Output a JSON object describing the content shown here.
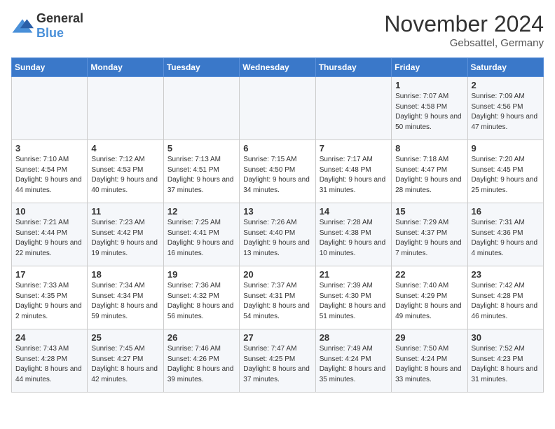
{
  "logo": {
    "general": "General",
    "blue": "Blue"
  },
  "title": "November 2024",
  "location": "Gebsattel, Germany",
  "weekdays": [
    "Sunday",
    "Monday",
    "Tuesday",
    "Wednesday",
    "Thursday",
    "Friday",
    "Saturday"
  ],
  "weeks": [
    [
      {
        "day": "",
        "sunrise": "",
        "sunset": "",
        "daylight": ""
      },
      {
        "day": "",
        "sunrise": "",
        "sunset": "",
        "daylight": ""
      },
      {
        "day": "",
        "sunrise": "",
        "sunset": "",
        "daylight": ""
      },
      {
        "day": "",
        "sunrise": "",
        "sunset": "",
        "daylight": ""
      },
      {
        "day": "",
        "sunrise": "",
        "sunset": "",
        "daylight": ""
      },
      {
        "day": "1",
        "sunrise": "Sunrise: 7:07 AM",
        "sunset": "Sunset: 4:58 PM",
        "daylight": "Daylight: 9 hours and 50 minutes."
      },
      {
        "day": "2",
        "sunrise": "Sunrise: 7:09 AM",
        "sunset": "Sunset: 4:56 PM",
        "daylight": "Daylight: 9 hours and 47 minutes."
      }
    ],
    [
      {
        "day": "3",
        "sunrise": "Sunrise: 7:10 AM",
        "sunset": "Sunset: 4:54 PM",
        "daylight": "Daylight: 9 hours and 44 minutes."
      },
      {
        "day": "4",
        "sunrise": "Sunrise: 7:12 AM",
        "sunset": "Sunset: 4:53 PM",
        "daylight": "Daylight: 9 hours and 40 minutes."
      },
      {
        "day": "5",
        "sunrise": "Sunrise: 7:13 AM",
        "sunset": "Sunset: 4:51 PM",
        "daylight": "Daylight: 9 hours and 37 minutes."
      },
      {
        "day": "6",
        "sunrise": "Sunrise: 7:15 AM",
        "sunset": "Sunset: 4:50 PM",
        "daylight": "Daylight: 9 hours and 34 minutes."
      },
      {
        "day": "7",
        "sunrise": "Sunrise: 7:17 AM",
        "sunset": "Sunset: 4:48 PM",
        "daylight": "Daylight: 9 hours and 31 minutes."
      },
      {
        "day": "8",
        "sunrise": "Sunrise: 7:18 AM",
        "sunset": "Sunset: 4:47 PM",
        "daylight": "Daylight: 9 hours and 28 minutes."
      },
      {
        "day": "9",
        "sunrise": "Sunrise: 7:20 AM",
        "sunset": "Sunset: 4:45 PM",
        "daylight": "Daylight: 9 hours and 25 minutes."
      }
    ],
    [
      {
        "day": "10",
        "sunrise": "Sunrise: 7:21 AM",
        "sunset": "Sunset: 4:44 PM",
        "daylight": "Daylight: 9 hours and 22 minutes."
      },
      {
        "day": "11",
        "sunrise": "Sunrise: 7:23 AM",
        "sunset": "Sunset: 4:42 PM",
        "daylight": "Daylight: 9 hours and 19 minutes."
      },
      {
        "day": "12",
        "sunrise": "Sunrise: 7:25 AM",
        "sunset": "Sunset: 4:41 PM",
        "daylight": "Daylight: 9 hours and 16 minutes."
      },
      {
        "day": "13",
        "sunrise": "Sunrise: 7:26 AM",
        "sunset": "Sunset: 4:40 PM",
        "daylight": "Daylight: 9 hours and 13 minutes."
      },
      {
        "day": "14",
        "sunrise": "Sunrise: 7:28 AM",
        "sunset": "Sunset: 4:38 PM",
        "daylight": "Daylight: 9 hours and 10 minutes."
      },
      {
        "day": "15",
        "sunrise": "Sunrise: 7:29 AM",
        "sunset": "Sunset: 4:37 PM",
        "daylight": "Daylight: 9 hours and 7 minutes."
      },
      {
        "day": "16",
        "sunrise": "Sunrise: 7:31 AM",
        "sunset": "Sunset: 4:36 PM",
        "daylight": "Daylight: 9 hours and 4 minutes."
      }
    ],
    [
      {
        "day": "17",
        "sunrise": "Sunrise: 7:33 AM",
        "sunset": "Sunset: 4:35 PM",
        "daylight": "Daylight: 9 hours and 2 minutes."
      },
      {
        "day": "18",
        "sunrise": "Sunrise: 7:34 AM",
        "sunset": "Sunset: 4:34 PM",
        "daylight": "Daylight: 8 hours and 59 minutes."
      },
      {
        "day": "19",
        "sunrise": "Sunrise: 7:36 AM",
        "sunset": "Sunset: 4:32 PM",
        "daylight": "Daylight: 8 hours and 56 minutes."
      },
      {
        "day": "20",
        "sunrise": "Sunrise: 7:37 AM",
        "sunset": "Sunset: 4:31 PM",
        "daylight": "Daylight: 8 hours and 54 minutes."
      },
      {
        "day": "21",
        "sunrise": "Sunrise: 7:39 AM",
        "sunset": "Sunset: 4:30 PM",
        "daylight": "Daylight: 8 hours and 51 minutes."
      },
      {
        "day": "22",
        "sunrise": "Sunrise: 7:40 AM",
        "sunset": "Sunset: 4:29 PM",
        "daylight": "Daylight: 8 hours and 49 minutes."
      },
      {
        "day": "23",
        "sunrise": "Sunrise: 7:42 AM",
        "sunset": "Sunset: 4:28 PM",
        "daylight": "Daylight: 8 hours and 46 minutes."
      }
    ],
    [
      {
        "day": "24",
        "sunrise": "Sunrise: 7:43 AM",
        "sunset": "Sunset: 4:28 PM",
        "daylight": "Daylight: 8 hours and 44 minutes."
      },
      {
        "day": "25",
        "sunrise": "Sunrise: 7:45 AM",
        "sunset": "Sunset: 4:27 PM",
        "daylight": "Daylight: 8 hours and 42 minutes."
      },
      {
        "day": "26",
        "sunrise": "Sunrise: 7:46 AM",
        "sunset": "Sunset: 4:26 PM",
        "daylight": "Daylight: 8 hours and 39 minutes."
      },
      {
        "day": "27",
        "sunrise": "Sunrise: 7:47 AM",
        "sunset": "Sunset: 4:25 PM",
        "daylight": "Daylight: 8 hours and 37 minutes."
      },
      {
        "day": "28",
        "sunrise": "Sunrise: 7:49 AM",
        "sunset": "Sunset: 4:24 PM",
        "daylight": "Daylight: 8 hours and 35 minutes."
      },
      {
        "day": "29",
        "sunrise": "Sunrise: 7:50 AM",
        "sunset": "Sunset: 4:24 PM",
        "daylight": "Daylight: 8 hours and 33 minutes."
      },
      {
        "day": "30",
        "sunrise": "Sunrise: 7:52 AM",
        "sunset": "Sunset: 4:23 PM",
        "daylight": "Daylight: 8 hours and 31 minutes."
      }
    ]
  ]
}
